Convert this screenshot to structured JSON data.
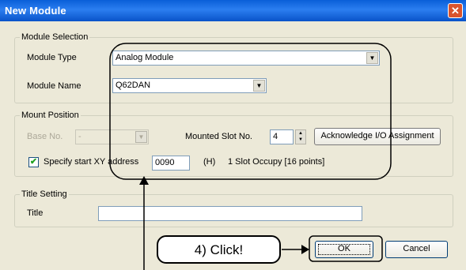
{
  "window": {
    "title": "New Module",
    "close_icon": "close-icon"
  },
  "module_selection": {
    "legend": "Module Selection",
    "module_type_label": "Module Type",
    "module_type_value": "Analog Module",
    "module_name_label": "Module Name",
    "module_name_value": "Q62DAN"
  },
  "mount_position": {
    "legend": "Mount Position",
    "base_no_label": "Base No.",
    "base_no_value": "-",
    "mounted_slot_label": "Mounted Slot No.",
    "mounted_slot_value": "4",
    "acknowledge_button": "Acknowledge I/O Assignment",
    "specify_checkbox_label": "Specify start XY address",
    "specify_checked": true,
    "address_value": "0090",
    "hex_label": "(H)",
    "slot_occupy_text": "1 Slot Occupy [16 points]"
  },
  "title_setting": {
    "legend": "Title Setting",
    "title_label": "Title",
    "title_value": ""
  },
  "buttons": {
    "ok": "OK",
    "cancel": "Cancel"
  },
  "annotation": {
    "callout": "4) Click!"
  }
}
